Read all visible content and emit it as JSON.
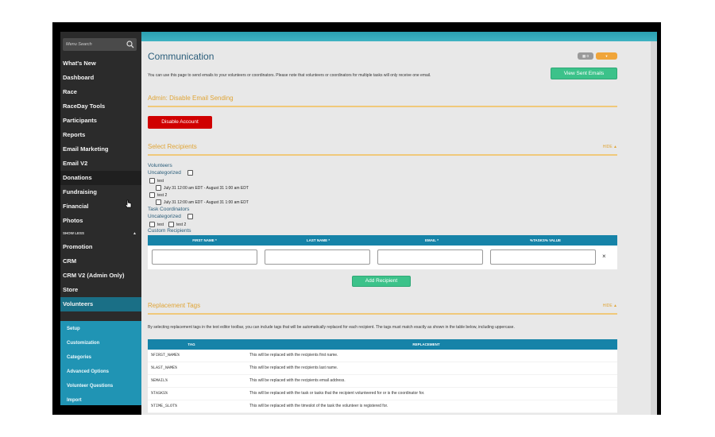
{
  "sidebar": {
    "search_placeholder": "Menu Search",
    "items": [
      {
        "label": "What's New"
      },
      {
        "label": "Dashboard"
      },
      {
        "label": "Race"
      },
      {
        "label": "RaceDay Tools"
      },
      {
        "label": "Participants"
      },
      {
        "label": "Reports"
      },
      {
        "label": "Email Marketing"
      },
      {
        "label": "Email V2"
      },
      {
        "label": "Donations"
      },
      {
        "label": "Fundraising"
      },
      {
        "label": "Financial"
      },
      {
        "label": "Photos"
      },
      {
        "label": "SHOW LESS"
      },
      {
        "label": "Promotion"
      },
      {
        "label": "CRM"
      },
      {
        "label": "CRM V2 (Admin Only)"
      },
      {
        "label": "Store"
      },
      {
        "label": "Volunteers"
      }
    ],
    "sub_items": [
      {
        "label": "Setup"
      },
      {
        "label": "Customization"
      },
      {
        "label": "Categories"
      },
      {
        "label": "Advanced Options"
      },
      {
        "label": "Volunteer Questions"
      },
      {
        "label": "Import"
      }
    ]
  },
  "header": {
    "title": "Communication",
    "pill_gray": "0",
    "pill_orange": "▾",
    "description": "You can use this page to send emails to your volunteers or coordinators. Please note that volunteers or coordinators for multiple tasks will only receive one email.",
    "view_sent_label": "View Sent Emails"
  },
  "admin_section": {
    "title": "Admin: Disable Email Sending",
    "button_label": "Disable Account"
  },
  "recipients": {
    "title": "Select Recipients",
    "hide_label": "HIDE",
    "volunteers_label": "Volunteers",
    "uncategorized_label": "Uncategorized",
    "test_label": "test",
    "slot1": "July 31 12:00 am EDT - August 31 1:00 am EDT",
    "test2_label": "test 2",
    "slot2": "July 31 12:00 am EDT - August 31 1:00 am EDT",
    "coordinators_label": "Task Coordinators",
    "coord_uncategorized": "Uncategorized",
    "coord_test": "test",
    "coord_test2": "test 2",
    "custom_label": "Custom Recipients",
    "columns": [
      "FIRST NAME *",
      "LAST NAME *",
      "EMAIL *",
      "%TASKS% VALUE"
    ],
    "remove_symbol": "×",
    "add_label": "Add Recipient"
  },
  "replacement": {
    "title": "Replacement Tags",
    "hide_label": "HIDE",
    "description": "By selecting replacement tags in the text editor toolbar, you can include tags that will be automatically replaced for each recipient. The tags must match exactly as shown in the table below, including uppercase.",
    "columns": [
      "TAG",
      "REPLACEMENT"
    ],
    "rows": [
      {
        "tag": "%FIRST_NAME%",
        "replacement": "This will be replaced with the recipients first name."
      },
      {
        "tag": "%LAST_NAME%",
        "replacement": "This will be replaced with the recipients last name."
      },
      {
        "tag": "%EMAIL%",
        "replacement": "This will be replaced with the recipients email address."
      },
      {
        "tag": "%TASKS%",
        "replacement": "This will be replaced with the task or tasks that the recipient volunteered for or is the coordinator for."
      },
      {
        "tag": "%TIME_SLOT%",
        "replacement": "This will be replaced with the timeslot of the task the volunteer is registered for."
      }
    ]
  },
  "colors": {
    "accent_orange": "#e0a537",
    "header_blue": "#1683a8",
    "sidebar_dark": "#2b2b2b",
    "sub_blue": "#2094b4",
    "green": "#3cc28a",
    "red": "#d00000"
  }
}
